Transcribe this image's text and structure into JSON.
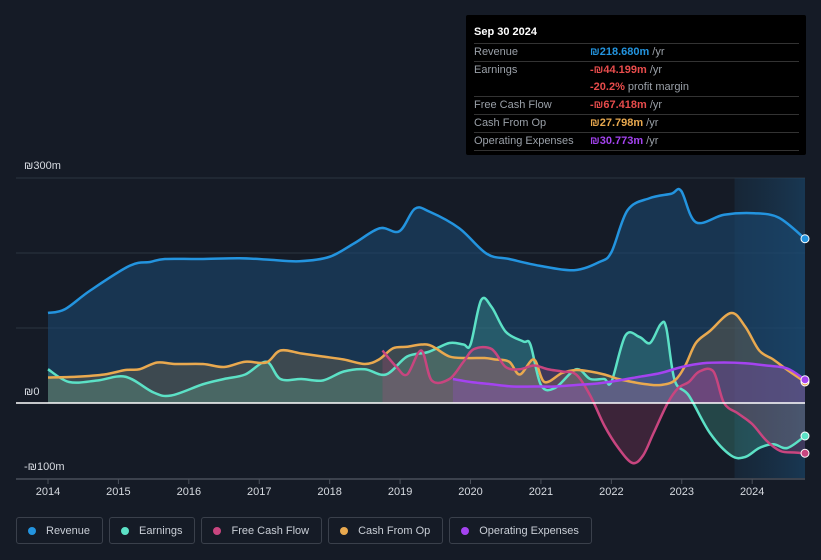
{
  "tooltip": {
    "date": "Sep 30 2024",
    "rows": [
      {
        "label": "Revenue",
        "value": "₪218.680m",
        "unit": "/yr",
        "color": "#2394df"
      },
      {
        "label": "Earnings",
        "value": "-₪44.199m",
        "unit": "/yr",
        "color": "#e84c4c"
      },
      {
        "label": "",
        "value": "-20.2%",
        "unit": "profit margin",
        "color": "#e84c4c"
      },
      {
        "label": "Free Cash Flow",
        "value": "-₪67.418m",
        "unit": "/yr",
        "color": "#e84c4c"
      },
      {
        "label": "Cash From Op",
        "value": "₪27.798m",
        "unit": "/yr",
        "color": "#e9a94f"
      },
      {
        "label": "Operating Expenses",
        "value": "₪30.773m",
        "unit": "/yr",
        "color": "#a443f0"
      }
    ]
  },
  "legend": [
    {
      "label": "Revenue",
      "color": "#2394df"
    },
    {
      "label": "Earnings",
      "color": "#5ce1c6"
    },
    {
      "label": "Free Cash Flow",
      "color": "#c8457f"
    },
    {
      "label": "Cash From Op",
      "color": "#e9a94f"
    },
    {
      "label": "Operating Expenses",
      "color": "#a443f0"
    }
  ],
  "chart_data": {
    "type": "area",
    "title": "",
    "xlabel": "",
    "ylabel": "",
    "ylim": [
      -100,
      300
    ],
    "xlim": [
      2014.0,
      2024.75
    ],
    "y_ticks": [
      {
        "value": 300,
        "label": "₪300m"
      },
      {
        "value": 0,
        "label": "₪0"
      },
      {
        "value": -100,
        "label": "-₪100m"
      }
    ],
    "x_ticks": [
      "2014",
      "2015",
      "2016",
      "2017",
      "2018",
      "2019",
      "2020",
      "2021",
      "2022",
      "2023",
      "2024"
    ],
    "grid": true,
    "highlight_from": 2023.75,
    "legend_position": "bottom-left",
    "series": [
      {
        "name": "Revenue",
        "color": "#2394df",
        "x": [
          2014.0,
          2014.24,
          2014.6,
          2015.16,
          2015.45,
          2015.66,
          2016.16,
          2016.72,
          2017.15,
          2017.57,
          2018.0,
          2018.35,
          2018.71,
          2018.99,
          2019.21,
          2019.42,
          2019.84,
          2020.23,
          2020.55,
          2020.98,
          2021.47,
          2021.83,
          2022.0,
          2022.23,
          2022.54,
          2022.85,
          2022.99,
          2023.2,
          2023.6,
          2024.03,
          2024.38,
          2024.75
        ],
        "values": [
          120,
          125,
          150,
          183,
          188,
          192,
          192,
          193,
          191,
          189,
          195,
          213,
          233,
          229,
          259,
          255,
          233,
          199,
          192,
          183,
          177,
          188,
          201,
          257,
          273,
          279,
          283,
          241,
          251,
          253,
          247,
          219
        ]
      },
      {
        "name": "Earnings",
        "color": "#5ce1c6",
        "x": [
          2014.0,
          2014.3,
          2014.7,
          2015.1,
          2015.5,
          2015.75,
          2016.2,
          2016.5,
          2016.8,
          2017.1,
          2017.3,
          2017.6,
          2017.9,
          2018.2,
          2018.5,
          2018.8,
          2019.1,
          2019.4,
          2019.7,
          2019.9,
          2020.0,
          2020.15,
          2020.3,
          2020.5,
          2020.75,
          2020.85,
          2021.0,
          2021.2,
          2021.5,
          2021.7,
          2021.9,
          2022.0,
          2022.2,
          2022.4,
          2022.55,
          2022.7,
          2022.78,
          2022.9,
          2023.1,
          2023.4,
          2023.7,
          2023.9,
          2024.1,
          2024.3,
          2024.5,
          2024.75
        ],
        "values": [
          45,
          28,
          30,
          35,
          14,
          10,
          25,
          32,
          38,
          55,
          32,
          32,
          30,
          42,
          45,
          38,
          62,
          68,
          80,
          78,
          78,
          137,
          128,
          95,
          82,
          78,
          24,
          20,
          45,
          32,
          32,
          28,
          90,
          88,
          80,
          105,
          100,
          30,
          10,
          -40,
          -70,
          -72,
          -60,
          -55,
          -60,
          -44
        ]
      },
      {
        "name": "Free Cash Flow",
        "color": "#c8457f",
        "start": 2018.75,
        "x": [
          2018.75,
          2018.95,
          2019.1,
          2019.3,
          2019.45,
          2019.7,
          2019.9,
          2020.05,
          2020.3,
          2020.5,
          2020.7,
          2020.9,
          2021.1,
          2021.3,
          2021.5,
          2021.7,
          2021.9,
          2022.1,
          2022.3,
          2022.45,
          2022.6,
          2022.8,
          2022.95,
          2023.1,
          2023.25,
          2023.45,
          2023.6,
          2023.8,
          2024.0,
          2024.2,
          2024.4,
          2024.6,
          2024.75
        ],
        "values": [
          70,
          48,
          38,
          70,
          30,
          32,
          55,
          72,
          72,
          48,
          45,
          50,
          45,
          42,
          38,
          10,
          -30,
          -60,
          -80,
          -70,
          -40,
          0,
          20,
          28,
          42,
          42,
          0,
          -14,
          -28,
          -50,
          -64,
          -66,
          -67
        ]
      },
      {
        "name": "Cash From Op",
        "color": "#e9a94f",
        "x": [
          2014.0,
          2014.4,
          2014.8,
          2015.1,
          2015.3,
          2015.55,
          2015.8,
          2016.2,
          2016.5,
          2016.8,
          2017.1,
          2017.3,
          2017.6,
          2017.9,
          2018.2,
          2018.5,
          2018.7,
          2018.9,
          2019.1,
          2019.3,
          2019.45,
          2019.7,
          2019.95,
          2020.2,
          2020.35,
          2020.55,
          2020.7,
          2020.9,
          2021.05,
          2021.3,
          2021.5,
          2021.7,
          2021.9,
          2022.1,
          2022.3,
          2022.5,
          2022.7,
          2022.9,
          2023.05,
          2023.2,
          2023.4,
          2023.7,
          2023.9,
          2024.1,
          2024.3,
          2024.5,
          2024.75
        ],
        "values": [
          34,
          35,
          38,
          44,
          45,
          54,
          52,
          52,
          48,
          55,
          54,
          70,
          66,
          62,
          58,
          52,
          58,
          73,
          75,
          78,
          76,
          62,
          60,
          60,
          58,
          55,
          38,
          58,
          28,
          40,
          44,
          42,
          38,
          32,
          28,
          25,
          24,
          30,
          50,
          80,
          96,
          120,
          102,
          70,
          58,
          44,
          28
        ]
      },
      {
        "name": "Operating Expenses",
        "color": "#a443f0",
        "start": 2019.75,
        "x": [
          2019.75,
          2020.0,
          2020.3,
          2020.6,
          2020.9,
          2021.2,
          2021.5,
          2021.8,
          2022.1,
          2022.4,
          2022.7,
          2023.0,
          2023.3,
          2023.6,
          2023.9,
          2024.2,
          2024.5,
          2024.75
        ],
        "values": [
          32,
          28,
          25,
          22,
          22,
          22,
          24,
          26,
          30,
          35,
          40,
          48,
          53,
          54,
          53,
          50,
          46,
          31
        ]
      }
    ]
  }
}
